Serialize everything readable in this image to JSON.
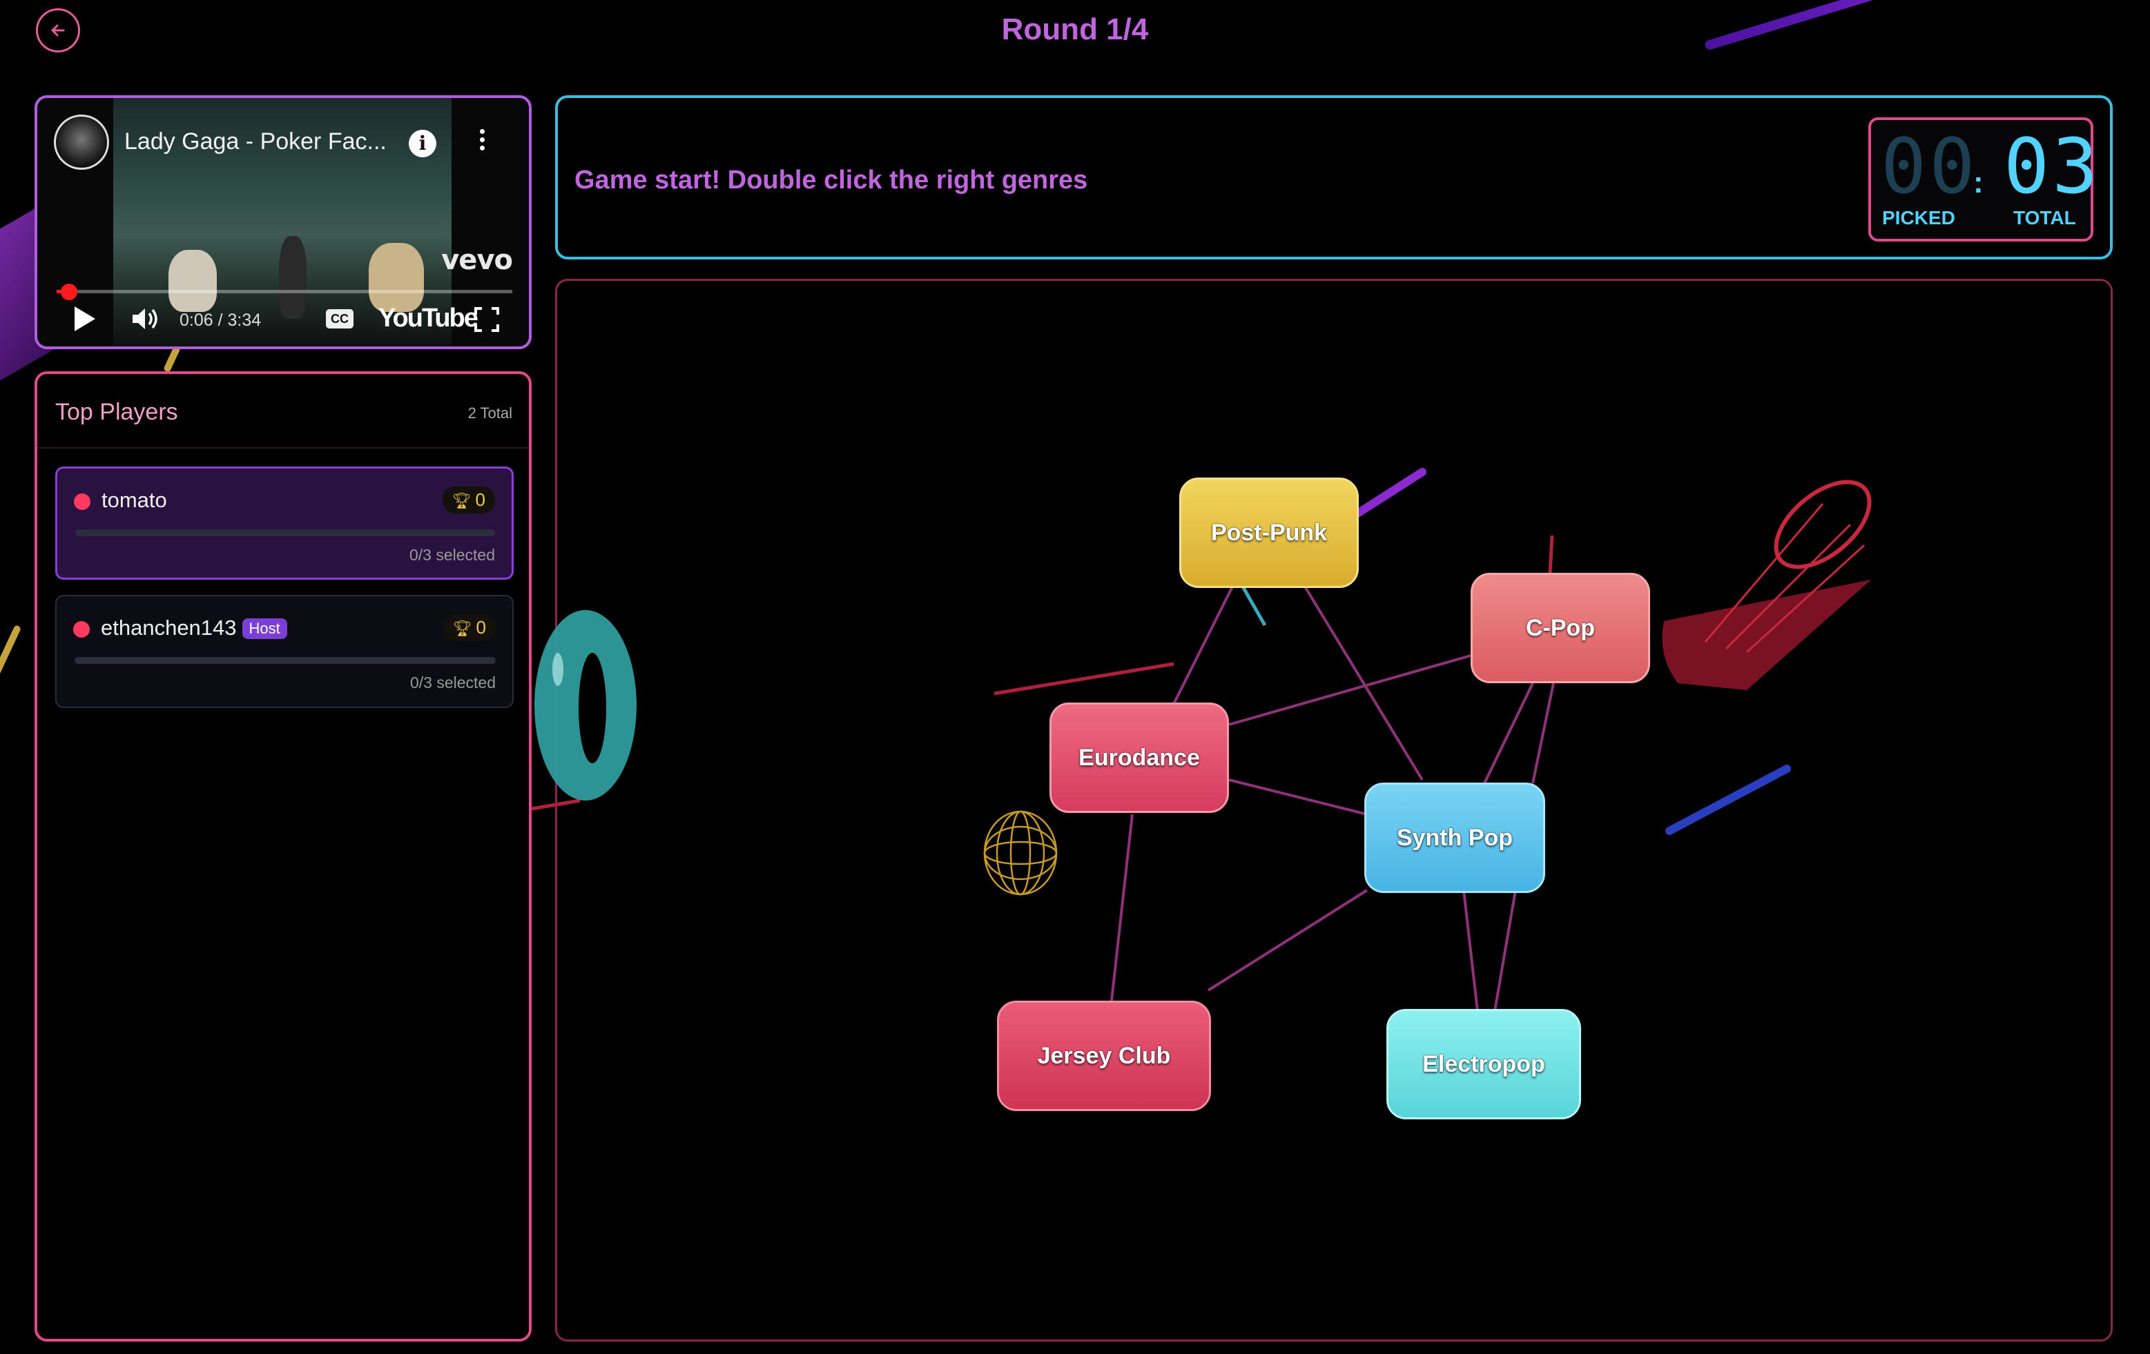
{
  "header": {
    "round_title": "Round 1/4"
  },
  "video": {
    "title": "Lady Gaga - Poker Fac...",
    "brand_mark": "vevo",
    "time": "0:06 / 3:34",
    "platform_label": "YouTube",
    "cc_label": "CC",
    "progress": 0.028
  },
  "players": {
    "title": "Top Players",
    "total_label": "2 Total",
    "list": [
      {
        "name": "tomato",
        "score": "0",
        "selected": "0/3 selected",
        "host": ""
      },
      {
        "name": "ethanchen143",
        "score": "0",
        "selected": "0/3 selected",
        "host": "Host"
      }
    ]
  },
  "game": {
    "message": "Game start! Double click the right genres",
    "picked_digits": "00",
    "total_digits": "03",
    "picked_label": "PICKED",
    "total_label": "TOTAL",
    "separator": ":"
  },
  "genres": [
    {
      "label": "Post-Punk",
      "color": "#e8c040"
    },
    {
      "label": "C-Pop",
      "color": "#e36c72"
    },
    {
      "label": "Eurodance",
      "color": "#e3506e"
    },
    {
      "label": "Synth Pop",
      "color": "#5cc6ee"
    },
    {
      "label": "Jersey Club",
      "color": "#de4464"
    },
    {
      "label": "Electropop",
      "color": "#6ee0e2"
    }
  ],
  "colors": {
    "accent_purple": "#c064e0",
    "accent_cyan": "#39bde0",
    "accent_pink": "#e04a8a",
    "link_line": "#a83a8e"
  }
}
